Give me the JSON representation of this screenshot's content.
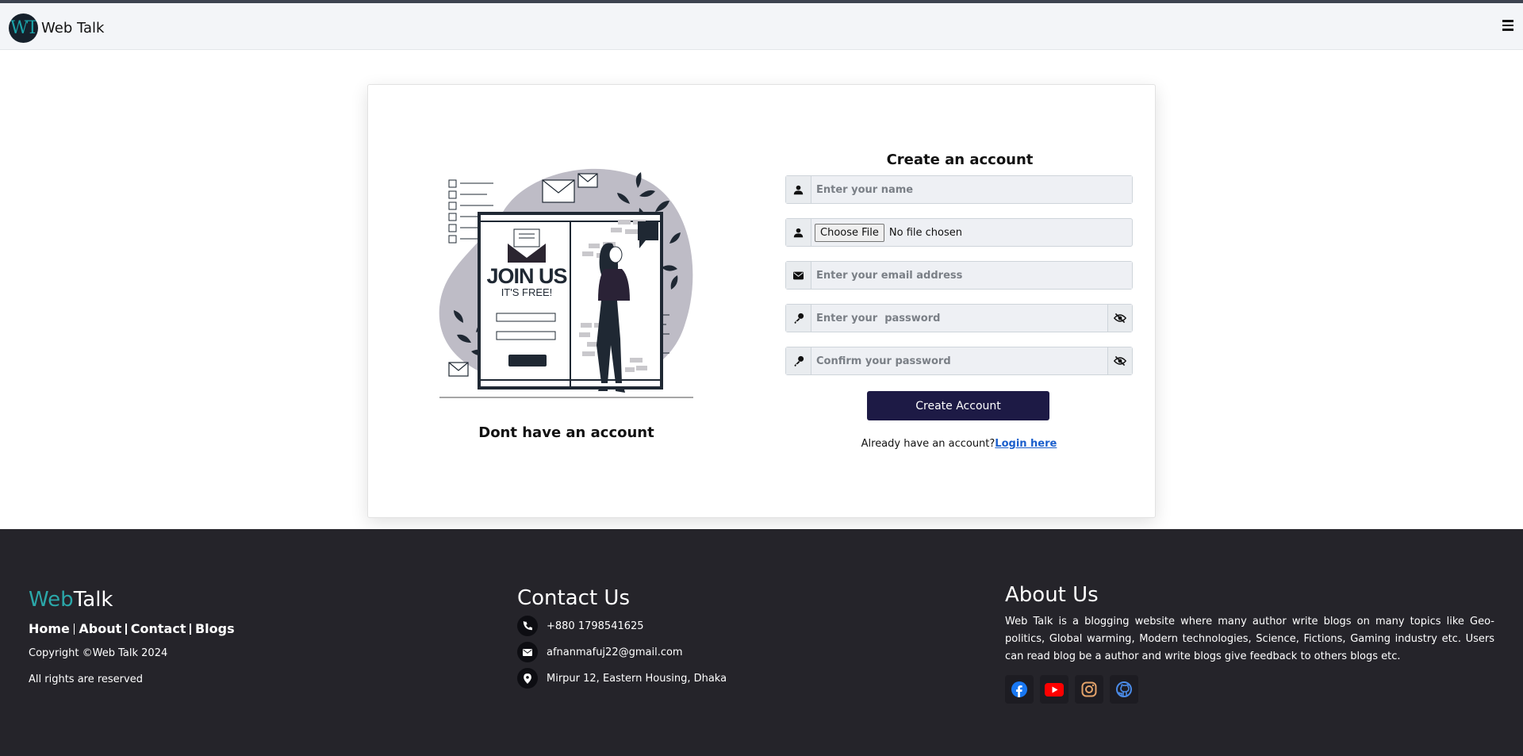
{
  "header": {
    "logo_text": "WT",
    "brand": "Web Talk"
  },
  "illustration": {
    "headline": "JOIN US",
    "subline": "IT'S FREE!",
    "caption": "Dont have an account"
  },
  "form": {
    "title": "Create an account",
    "name_placeholder": "Enter your name",
    "file_button": "Choose File",
    "file_status": "No file chosen",
    "email_placeholder": "Enter your email address",
    "password_placeholder": "Enter your  password",
    "confirm_placeholder": "Confirm your password",
    "submit_label": "Create Account",
    "login_prompt": "Already have an account?",
    "login_link": "Login here"
  },
  "footer": {
    "logo_web": "Web",
    "logo_talk": "Talk",
    "links": [
      "Home",
      "About",
      "Contact",
      "Blogs"
    ],
    "copyright": "Copyright ©Web Talk 2024",
    "rights": "All rights are reserved",
    "contact_title": "Contact Us",
    "phone": "+880 1798541625",
    "email": "afnanmafuj22@gmail.com",
    "address": "Mirpur 12, Eastern Housing, Dhaka",
    "about_title": "About Us",
    "about_text": "Web Talk is a blogging website where many author write blogs on many topics like Geo-politics, Global warming, Modern technologies, Science, Fictions, Gaming industry etc. Users can read blog be a author and write blogs give feedback to others blogs etc.",
    "socials": [
      "facebook-icon",
      "youtube-icon",
      "instagram-icon",
      "github-icon"
    ]
  },
  "colors": {
    "accent_teal": "#2ba7a9",
    "button_navy": "#1d1a45",
    "footer_bg": "#25242a",
    "link_blue": "#1b5fcc"
  }
}
